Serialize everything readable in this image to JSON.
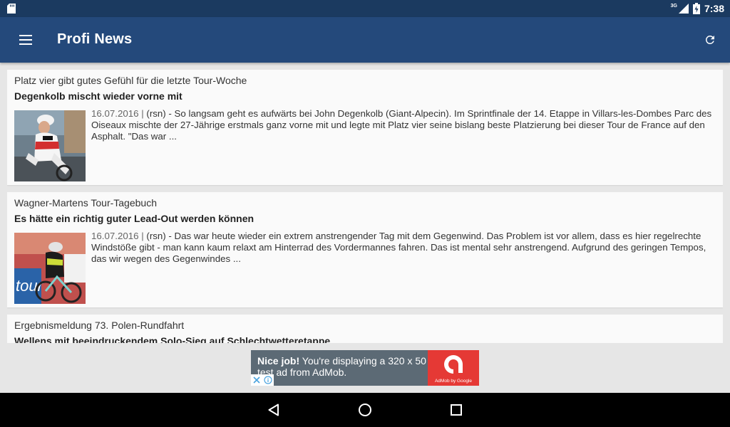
{
  "status_bar": {
    "network": "3G",
    "time": "7:38"
  },
  "app_bar": {
    "title": "Profi News",
    "menu_icon": "menu-icon",
    "refresh_icon": "refresh-icon",
    "color": "#24497b"
  },
  "articles": [
    {
      "kicker": "Platz vier gibt gutes Gefühl für die letzte Tour-Woche",
      "headline": "Degenkolb mischt wieder vorne mit",
      "date": "16.07.2016 |",
      "teaser": " (rsn) - So langsam geht es aufwärts bei John Degenkolb (Giant-Alpecin). Im Sprintfinale der 14. Etappe in Villars-les-Dombes Parc des Oiseaux mischte der 27-Jährige erstmals ganz vorne mit und legte mit Platz vier seine bislang beste Platzierung bei dieser Tour de France auf den Asphalt. \"Das war ..."
    },
    {
      "kicker": "Wagner-Martens Tour-Tagebuch",
      "headline": "Es hätte ein richtig guter Lead-Out werden können",
      "date": "16.07.2016 |",
      "teaser": " (rsn) - Das war heute wieder ein extrem anstrengender Tag mit dem Gegenwind. Das Problem ist vor allem, dass es hier regelrechte Windstöße gibt - man kann kaum relaxt am Hinterrad des Vordermannes fahren. Das ist mental sehr anstrengend. Aufgrund des geringen Tempos, das wir wegen des Gegenwindes ..."
    },
    {
      "kicker": "Ergebnismeldung 73. Polen-Rundfahrt",
      "headline": "Wellens mit beeindruckendem Solo-Sieg auf Schlechtwetteretappe",
      "date": "",
      "teaser": ""
    }
  ],
  "ad": {
    "bold": "Nice job!",
    "text": " You're displaying a 320 x 50 test ad from AdMob.",
    "brand": "AdMob by Google"
  }
}
